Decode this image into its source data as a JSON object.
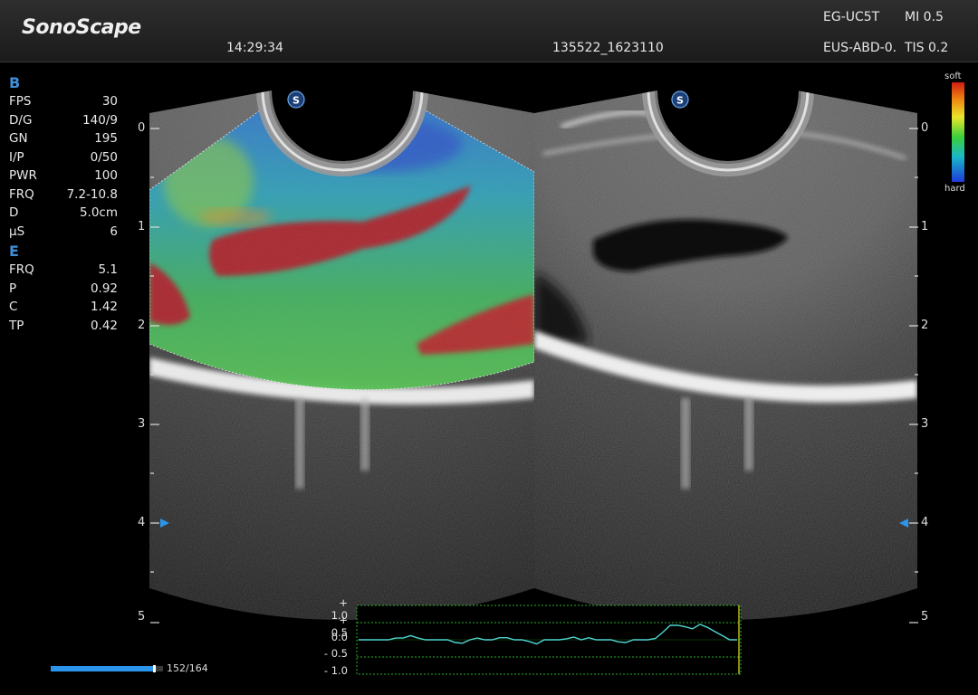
{
  "header": {
    "brand": "SonoScape",
    "time": "14:29:34",
    "patient_id": "135522_1623110",
    "probe": "EG-UC5T",
    "preset": "EUS-ABD-0.",
    "mi": "MI 0.5",
    "tis": "TIS 0.2"
  },
  "b_mode": {
    "title": "B",
    "rows": [
      {
        "k": "FPS",
        "v": "30"
      },
      {
        "k": "D/G",
        "v": "140/9"
      },
      {
        "k": "GN",
        "v": "195"
      },
      {
        "k": "I/P",
        "v": "0/50"
      },
      {
        "k": "PWR",
        "v": "100"
      },
      {
        "k": "FRQ",
        "v": "7.2-10.8"
      },
      {
        "k": "D",
        "v": "5.0cm"
      },
      {
        "k": "µS",
        "v": "6"
      }
    ]
  },
  "e_mode": {
    "title": "E",
    "rows": [
      {
        "k": "FRQ",
        "v": "5.1"
      },
      {
        "k": "P",
        "v": "0.92"
      },
      {
        "k": "C",
        "v": "1.42"
      },
      {
        "k": "TP",
        "v": "0.42"
      }
    ]
  },
  "depth_scale": [
    "0",
    "1",
    "2",
    "3",
    "4",
    "5"
  ],
  "colorbar": {
    "top_label": "soft",
    "bottom_label": "hard"
  },
  "cine": {
    "current": 152,
    "total": 164,
    "label": "152/164"
  },
  "strain_graph": {
    "y_labels": [
      "+ 1.0",
      "+ 0.5",
      "0.0",
      "- 0.5",
      "- 1.0"
    ],
    "trace_color": "#4ed6d0",
    "grid_color": "#27b02e",
    "values": [
      0.0,
      0.0,
      0.0,
      0.0,
      0.0,
      0.05,
      0.05,
      0.12,
      0.05,
      0.0,
      0.0,
      0.0,
      0.0,
      -0.08,
      -0.1,
      0.0,
      0.05,
      0.0,
      0.0,
      0.06,
      0.06,
      0.0,
      0.0,
      -0.05,
      -0.12,
      0.0,
      0.0,
      0.0,
      0.03,
      0.08,
      0.0,
      0.06,
      0.0,
      0.0,
      0.0,
      -0.06,
      -0.08,
      0.0,
      0.0,
      0.0,
      0.04,
      0.22,
      0.42,
      0.42,
      0.38,
      0.32,
      0.45,
      0.36,
      0.24,
      0.12,
      0.0,
      0.0
    ]
  }
}
